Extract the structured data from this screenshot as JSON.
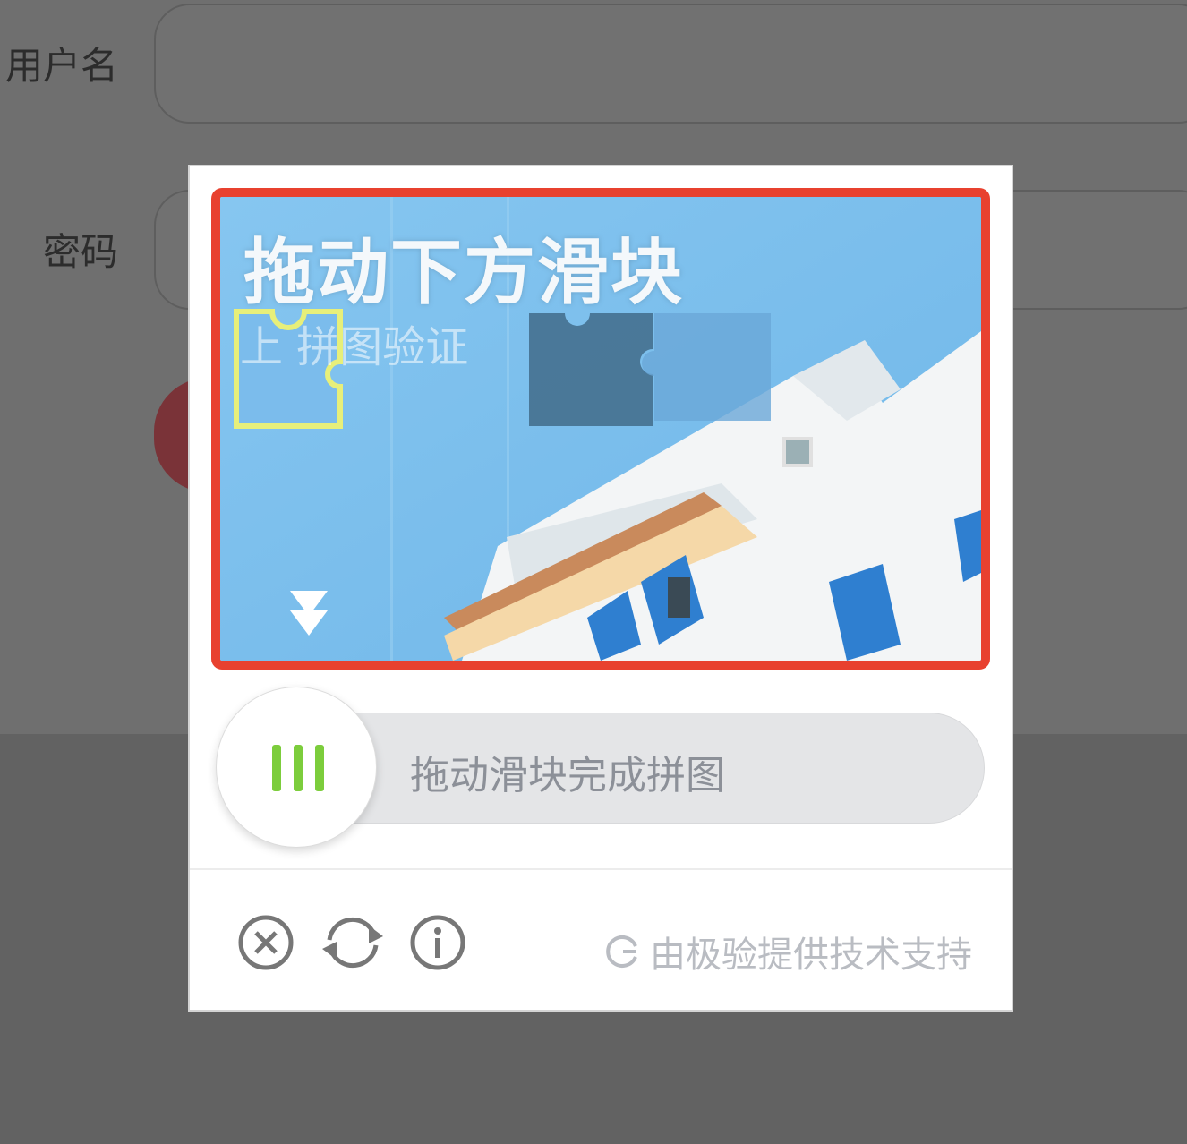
{
  "login_form": {
    "username_label": "用户名",
    "password_label": "密码"
  },
  "captcha": {
    "image_title": "拖动下方滑块",
    "image_subtitle": "上  拼图验证",
    "slider_hint": "拖动滑块完成拼图",
    "brand_text": "由极验提供技术支持",
    "icons": [
      "close-icon",
      "refresh-icon",
      "info-icon",
      "geetest-logo-icon"
    ],
    "colors": {
      "highlight_border": "#e8412f",
      "slider_bar": "#7ccd3c",
      "sky": "#8fcbf2"
    }
  }
}
